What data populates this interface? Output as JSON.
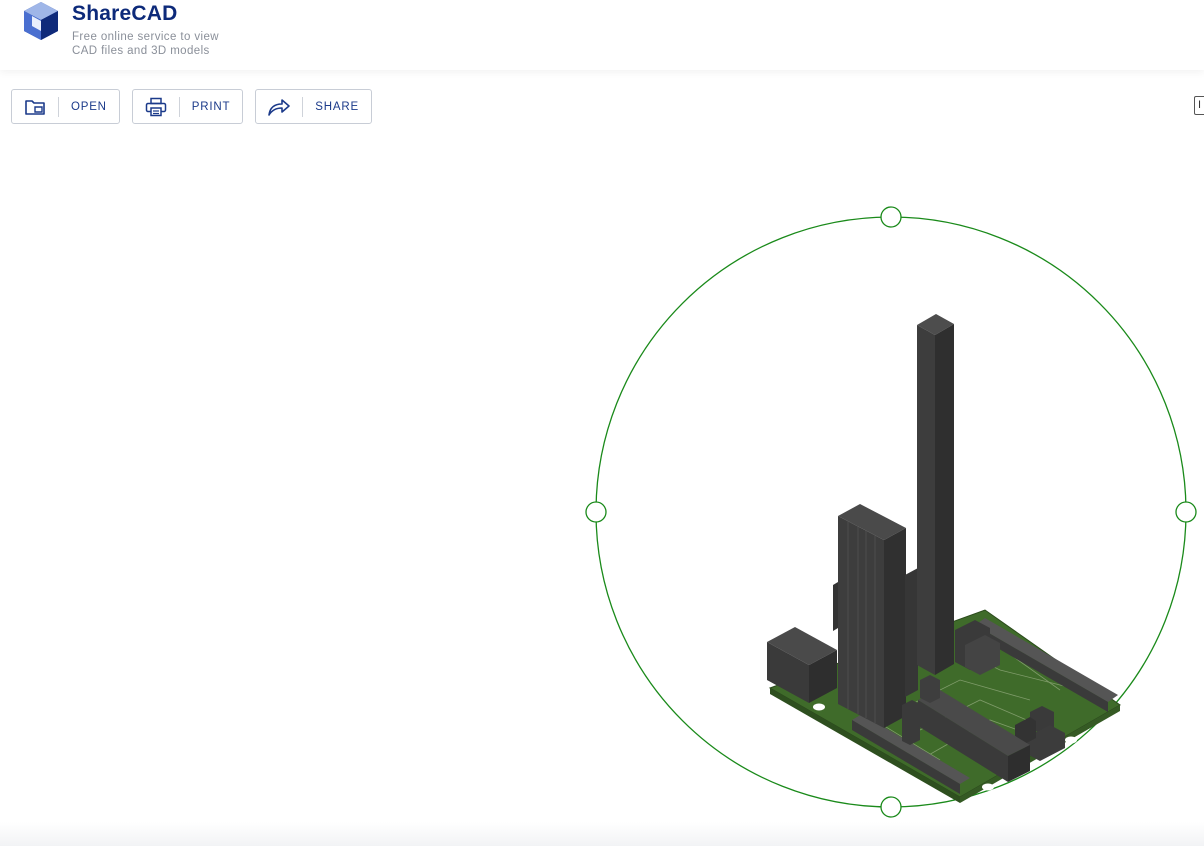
{
  "app": {
    "title": "ShareCAD",
    "subtitle_line1": "Free online service to view",
    "subtitle_line2": "CAD files and 3D models"
  },
  "toolbar": {
    "open_label": "OPEN",
    "print_label": "PRINT",
    "share_label": "SHARE"
  },
  "edge_button": {
    "label": "I"
  },
  "colors": {
    "brand": "#0d2a7a",
    "orbit_ring": "#1a8a1a",
    "board": "#3f6b2a",
    "component": "#3c3c3c"
  },
  "icons": {
    "open": "folder-icon",
    "print": "printer-icon",
    "share": "share-arrow-icon"
  }
}
